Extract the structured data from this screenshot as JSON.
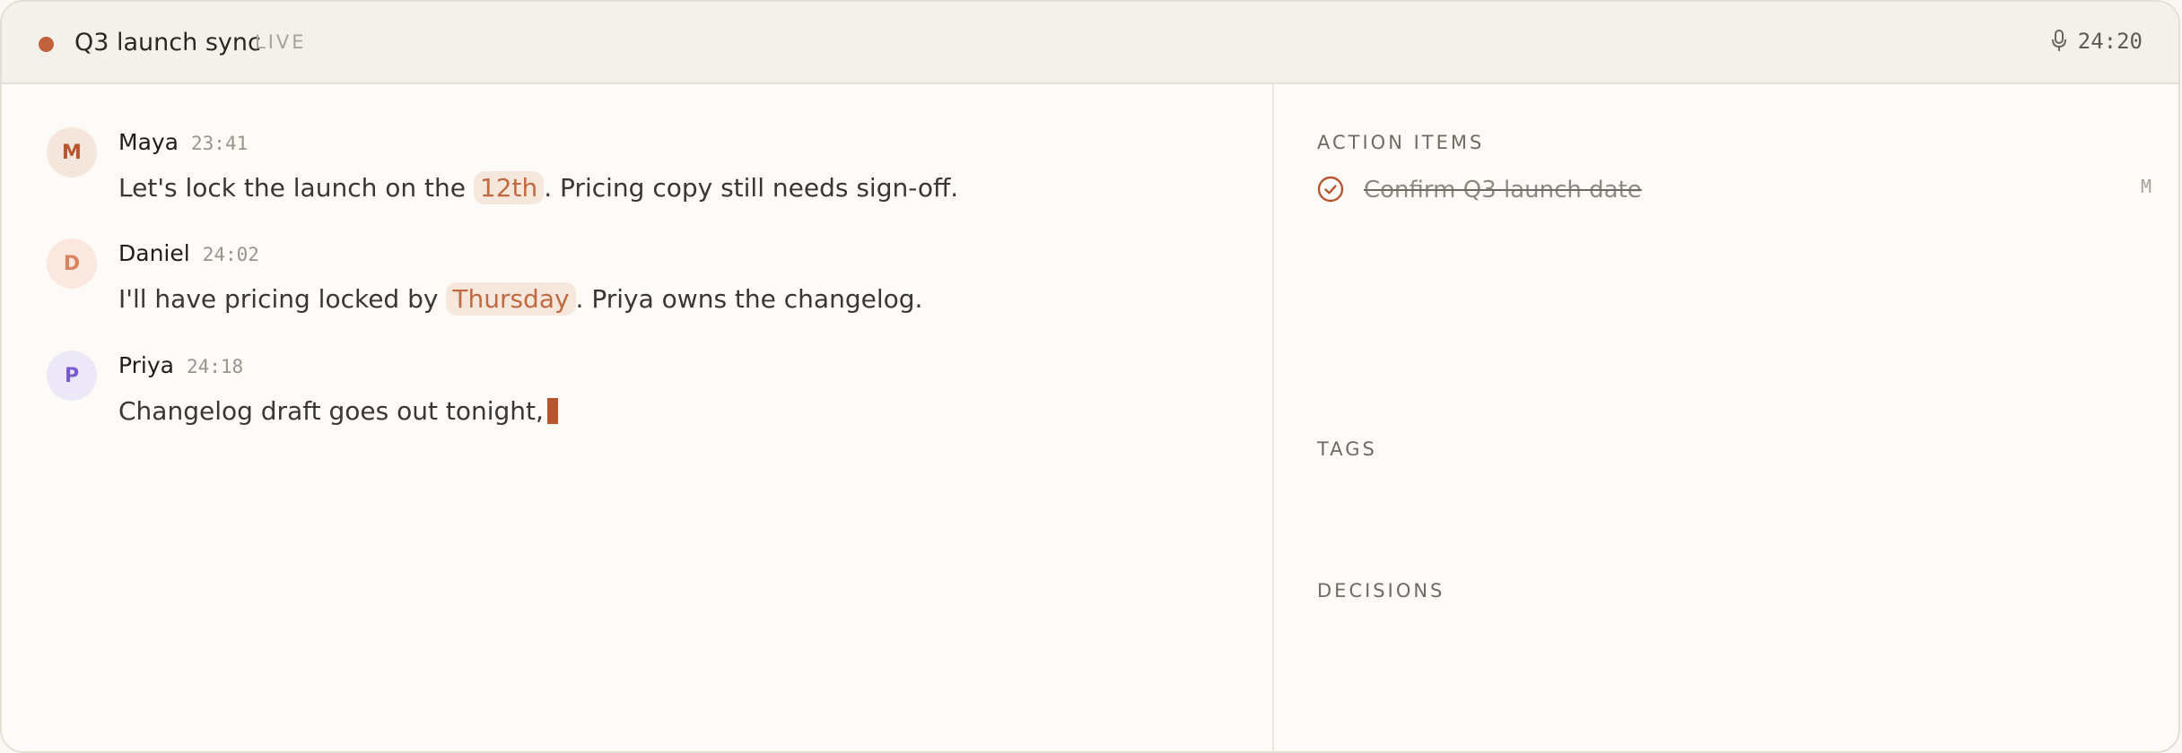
{
  "header": {
    "title": "Q3 launch sync",
    "status": "LIVE",
    "elapsed": "24:20"
  },
  "colors": {
    "accent": "#b8552f",
    "live_dot": "#c0623c",
    "maya_bg": "#f4e6dc",
    "maya_fg": "#b8552f",
    "daniel_bg": "#fae8e0",
    "daniel_fg": "#d9825f",
    "priya_bg": "#ece8f7",
    "priya_fg": "#7a5ad0"
  },
  "transcript": [
    {
      "initial": "M",
      "speaker": "Maya",
      "time": "23:41",
      "before": "Let's lock the launch on the ",
      "chip": "12th",
      "after": ". Pricing copy still needs sign-off."
    },
    {
      "initial": "D",
      "speaker": "Daniel",
      "time": "24:02",
      "before": "I'll have pricing locked by ",
      "chip": "Thursday",
      "after": ". Priya owns the changelog."
    },
    {
      "initial": "P",
      "speaker": "Priya",
      "time": "24:18",
      "before": "Changelog draft goes out tonight,"
    }
  ],
  "sidebar": {
    "action_items_heading": "ACTION ITEMS",
    "action_items": [
      {
        "text": "Confirm Q3 launch date",
        "owner": "M",
        "done": true
      }
    ],
    "tags_heading": "TAGS",
    "decisions_heading": "DECISIONS"
  }
}
